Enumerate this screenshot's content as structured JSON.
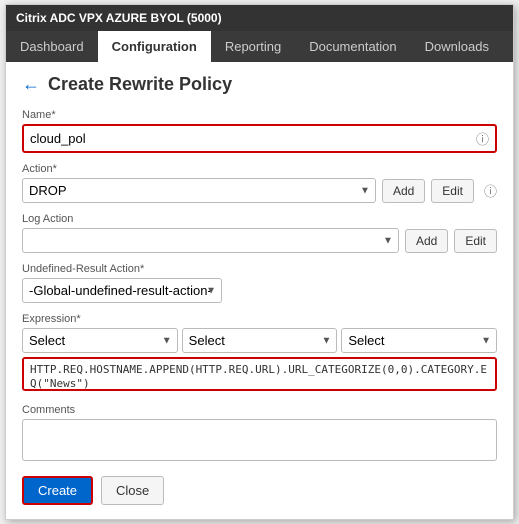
{
  "titleBar": {
    "label": "Citrix ADC VPX AZURE BYOL (5000)"
  },
  "nav": {
    "items": [
      {
        "id": "dashboard",
        "label": "Dashboard",
        "active": false
      },
      {
        "id": "configuration",
        "label": "Configuration",
        "active": true
      },
      {
        "id": "reporting",
        "label": "Reporting",
        "active": false
      },
      {
        "id": "documentation",
        "label": "Documentation",
        "active": false
      },
      {
        "id": "downloads",
        "label": "Downloads",
        "active": false
      }
    ]
  },
  "page": {
    "title": "Create Rewrite Policy",
    "backArrow": "←"
  },
  "form": {
    "nameLabel": "Name*",
    "nameValue": "cloud_pol",
    "actionLabel": "Action*",
    "actionValue": "DROP",
    "logActionLabel": "Log Action",
    "logActionValue": "",
    "undefinedResultActionLabel": "Undefined-Result Action*",
    "undefinedResultActionValue": "-Global-undefined-result-action-",
    "expressionLabel": "Expression*",
    "expressionSelect1": "Select",
    "expressionSelect2": "Select",
    "expressionSelect3": "Select",
    "expressionValue": "HTTP.REQ.HOSTNAME.APPEND(HTTP.REQ.URL).URL_CATEGORIZE(0,0).CATEGORY.EQ(\"News\")",
    "commentsLabel": "Comments",
    "createButton": "Create",
    "closeButton": "Close",
    "addButton1": "Add",
    "editButton1": "Edit",
    "addButton2": "Add",
    "editButton2": "Edit"
  }
}
